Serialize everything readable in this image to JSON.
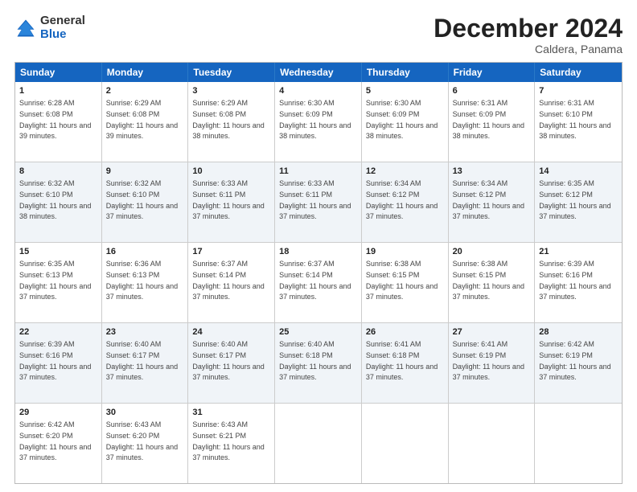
{
  "logo": {
    "general": "General",
    "blue": "Blue"
  },
  "title": {
    "month": "December 2024",
    "location": "Caldera, Panama"
  },
  "header_days": [
    "Sunday",
    "Monday",
    "Tuesday",
    "Wednesday",
    "Thursday",
    "Friday",
    "Saturday"
  ],
  "weeks": [
    [
      {
        "day": "1",
        "sunrise": "6:28 AM",
        "sunset": "6:08 PM",
        "daylight": "11 hours and 39 minutes"
      },
      {
        "day": "2",
        "sunrise": "6:29 AM",
        "sunset": "6:08 PM",
        "daylight": "11 hours and 39 minutes"
      },
      {
        "day": "3",
        "sunrise": "6:29 AM",
        "sunset": "6:08 PM",
        "daylight": "11 hours and 38 minutes"
      },
      {
        "day": "4",
        "sunrise": "6:30 AM",
        "sunset": "6:09 PM",
        "daylight": "11 hours and 38 minutes"
      },
      {
        "day": "5",
        "sunrise": "6:30 AM",
        "sunset": "6:09 PM",
        "daylight": "11 hours and 38 minutes"
      },
      {
        "day": "6",
        "sunrise": "6:31 AM",
        "sunset": "6:09 PM",
        "daylight": "11 hours and 38 minutes"
      },
      {
        "day": "7",
        "sunrise": "6:31 AM",
        "sunset": "6:10 PM",
        "daylight": "11 hours and 38 minutes"
      }
    ],
    [
      {
        "day": "8",
        "sunrise": "6:32 AM",
        "sunset": "6:10 PM",
        "daylight": "11 hours and 38 minutes"
      },
      {
        "day": "9",
        "sunrise": "6:32 AM",
        "sunset": "6:10 PM",
        "daylight": "11 hours and 37 minutes"
      },
      {
        "day": "10",
        "sunrise": "6:33 AM",
        "sunset": "6:11 PM",
        "daylight": "11 hours and 37 minutes"
      },
      {
        "day": "11",
        "sunrise": "6:33 AM",
        "sunset": "6:11 PM",
        "daylight": "11 hours and 37 minutes"
      },
      {
        "day": "12",
        "sunrise": "6:34 AM",
        "sunset": "6:12 PM",
        "daylight": "11 hours and 37 minutes"
      },
      {
        "day": "13",
        "sunrise": "6:34 AM",
        "sunset": "6:12 PM",
        "daylight": "11 hours and 37 minutes"
      },
      {
        "day": "14",
        "sunrise": "6:35 AM",
        "sunset": "6:12 PM",
        "daylight": "11 hours and 37 minutes"
      }
    ],
    [
      {
        "day": "15",
        "sunrise": "6:35 AM",
        "sunset": "6:13 PM",
        "daylight": "11 hours and 37 minutes"
      },
      {
        "day": "16",
        "sunrise": "6:36 AM",
        "sunset": "6:13 PM",
        "daylight": "11 hours and 37 minutes"
      },
      {
        "day": "17",
        "sunrise": "6:37 AM",
        "sunset": "6:14 PM",
        "daylight": "11 hours and 37 minutes"
      },
      {
        "day": "18",
        "sunrise": "6:37 AM",
        "sunset": "6:14 PM",
        "daylight": "11 hours and 37 minutes"
      },
      {
        "day": "19",
        "sunrise": "6:38 AM",
        "sunset": "6:15 PM",
        "daylight": "11 hours and 37 minutes"
      },
      {
        "day": "20",
        "sunrise": "6:38 AM",
        "sunset": "6:15 PM",
        "daylight": "11 hours and 37 minutes"
      },
      {
        "day": "21",
        "sunrise": "6:39 AM",
        "sunset": "6:16 PM",
        "daylight": "11 hours and 37 minutes"
      }
    ],
    [
      {
        "day": "22",
        "sunrise": "6:39 AM",
        "sunset": "6:16 PM",
        "daylight": "11 hours and 37 minutes"
      },
      {
        "day": "23",
        "sunrise": "6:40 AM",
        "sunset": "6:17 PM",
        "daylight": "11 hours and 37 minutes"
      },
      {
        "day": "24",
        "sunrise": "6:40 AM",
        "sunset": "6:17 PM",
        "daylight": "11 hours and 37 minutes"
      },
      {
        "day": "25",
        "sunrise": "6:40 AM",
        "sunset": "6:18 PM",
        "daylight": "11 hours and 37 minutes"
      },
      {
        "day": "26",
        "sunrise": "6:41 AM",
        "sunset": "6:18 PM",
        "daylight": "11 hours and 37 minutes"
      },
      {
        "day": "27",
        "sunrise": "6:41 AM",
        "sunset": "6:19 PM",
        "daylight": "11 hours and 37 minutes"
      },
      {
        "day": "28",
        "sunrise": "6:42 AM",
        "sunset": "6:19 PM",
        "daylight": "11 hours and 37 minutes"
      }
    ],
    [
      {
        "day": "29",
        "sunrise": "6:42 AM",
        "sunset": "6:20 PM",
        "daylight": "11 hours and 37 minutes"
      },
      {
        "day": "30",
        "sunrise": "6:43 AM",
        "sunset": "6:20 PM",
        "daylight": "11 hours and 37 minutes"
      },
      {
        "day": "31",
        "sunrise": "6:43 AM",
        "sunset": "6:21 PM",
        "daylight": "11 hours and 37 minutes"
      },
      null,
      null,
      null,
      null
    ]
  ]
}
